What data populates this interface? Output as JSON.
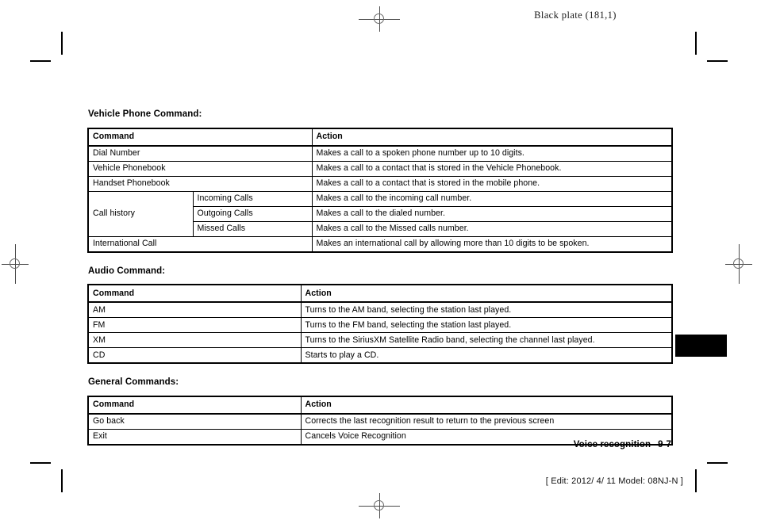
{
  "page": {
    "running_head": "Black plate (181,1)",
    "footer_section": "Voice recognition",
    "footer_page": "9-7",
    "edit_line": "[ Edit: 2012/ 4/ 11   Model: 08NJ-N ]"
  },
  "sections": [
    {
      "title": "Vehicle Phone Command:",
      "headers": {
        "command": "Command",
        "action": "Action"
      },
      "rows": [
        {
          "command": "Dial Number",
          "sub": "",
          "action": "Makes a call to a spoken phone number up to 10 digits."
        },
        {
          "command": "Vehicle Phonebook",
          "sub": "",
          "action": "Makes a call to a contact that is stored in the Vehicle Phonebook."
        },
        {
          "command": "Handset Phonebook",
          "sub": "",
          "action": "Makes a call to a contact that is stored in the mobile phone."
        },
        {
          "command": "Call history",
          "sub": "Incoming Calls",
          "action": "Makes a call to the incoming call number."
        },
        {
          "command": "",
          "sub": "Outgoing Calls",
          "action": "Makes a call to the dialed number."
        },
        {
          "command": "",
          "sub": "Missed Calls",
          "action": "Makes a call to the Missed calls number."
        },
        {
          "command": "International Call",
          "sub": "",
          "action": "Makes an international call by allowing more than 10 digits to be spoken."
        }
      ]
    },
    {
      "title": "Audio Command:",
      "headers": {
        "command": "Command",
        "action": "Action"
      },
      "rows": [
        {
          "command": "AM",
          "action": "Turns to the AM band, selecting the station last played."
        },
        {
          "command": "FM",
          "action": "Turns to the FM band, selecting the station last played."
        },
        {
          "command": "XM",
          "action": "Turns to the SiriusXM Satellite Radio band, selecting the channel last played."
        },
        {
          "command": "CD",
          "action": "Starts to play a CD."
        }
      ]
    },
    {
      "title": "General Commands:",
      "headers": {
        "command": "Command",
        "action": "Action"
      },
      "rows": [
        {
          "command": "Go back",
          "action": "Corrects the last recognition result to return to the previous screen"
        },
        {
          "command": "Exit",
          "action": "Cancels Voice Recognition"
        }
      ]
    }
  ]
}
